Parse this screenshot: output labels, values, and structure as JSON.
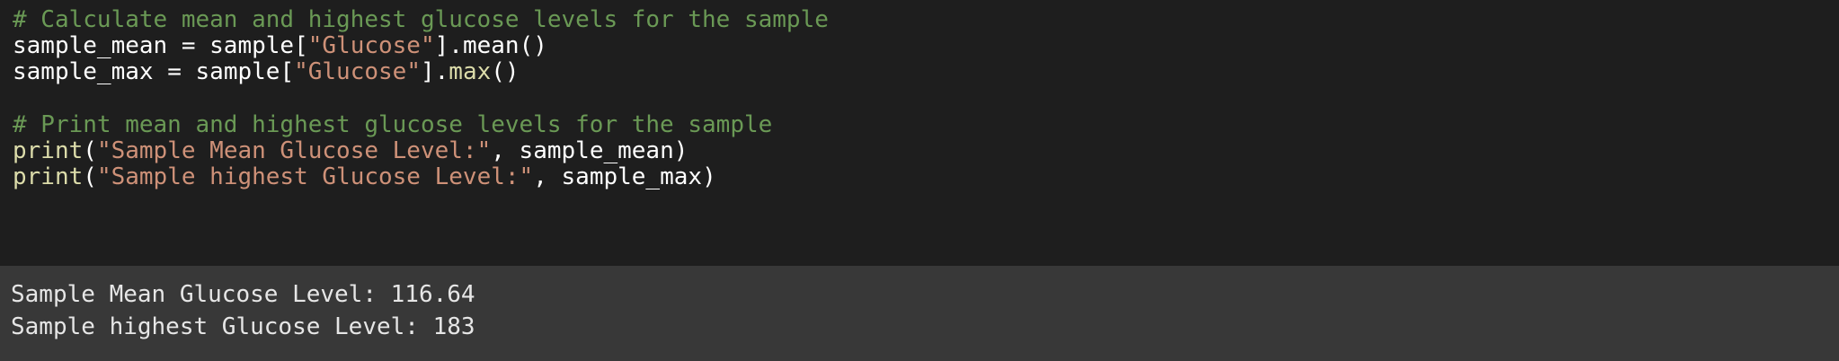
{
  "code": {
    "comment_1": "# Calculate mean and highest glucose levels for the sample",
    "line_mean": {
      "var": "sample_mean",
      "assign": " = ",
      "obj": "sample",
      "open": "[",
      "key": "\"Glucose\"",
      "close": "].",
      "method": "mean",
      "call": "()"
    },
    "line_max": {
      "var": "sample_max",
      "assign": " = ",
      "obj": "sample",
      "open": "[",
      "key": "\"Glucose\"",
      "close": "].",
      "method": "max",
      "call": "()"
    },
    "comment_2": "# Print mean and highest glucose levels for the sample",
    "print_mean": {
      "fn": "print",
      "open": "(",
      "text": "\"Sample Mean Glucose Level:\"",
      "sep": ", ",
      "arg": "sample_mean",
      "close": ")"
    },
    "print_max": {
      "fn": "print",
      "open": "(",
      "text": "\"Sample highest Glucose Level:\"",
      "sep": ", ",
      "arg": "sample_max",
      "close": ")"
    }
  },
  "output": {
    "line_1": "Sample Mean Glucose Level: 116.64",
    "line_2": "Sample highest Glucose Level: 183"
  },
  "colors": {
    "code_background": "#1e1e1e",
    "output_background": "#383838",
    "comment": "#6a9955",
    "string": "#ce9178",
    "function": "#dcdcaa",
    "identifier": "#ffffff"
  }
}
